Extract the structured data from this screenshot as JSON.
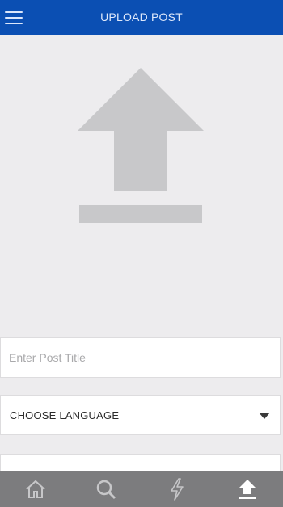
{
  "header": {
    "title": "UPLOAD POST",
    "menu_icon": "hamburger-menu-icon",
    "background_color": "#0b4fb3"
  },
  "upload": {
    "icon": "upload-arrow-icon",
    "icon_color": "#c8c8ca"
  },
  "form": {
    "post_title_placeholder": "Enter Post Title",
    "post_title_value": "",
    "language_selected": "CHOOSE LANGUAGE",
    "language_icon": "chevron-down-icon"
  },
  "tabbar": {
    "background_color": "#7c7c7e",
    "items": [
      {
        "icon": "home-icon",
        "active": false
      },
      {
        "icon": "search-icon",
        "active": false
      },
      {
        "icon": "lightning-icon",
        "active": false
      },
      {
        "icon": "upload-icon",
        "active": true
      }
    ]
  }
}
